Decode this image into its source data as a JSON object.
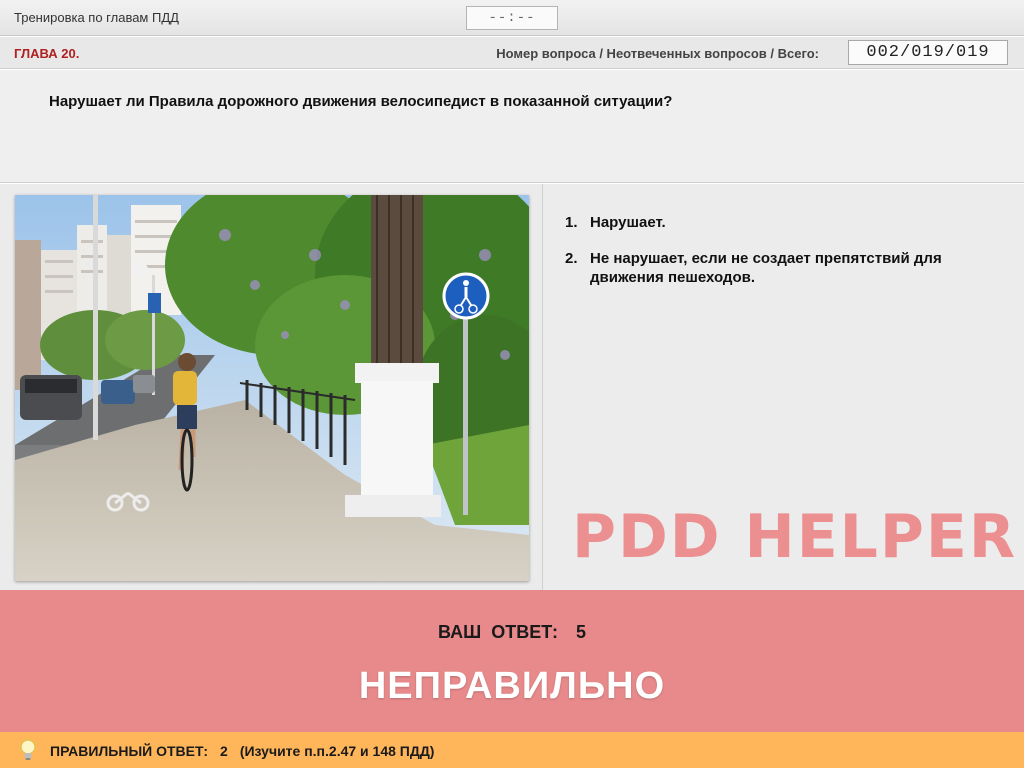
{
  "header": {
    "title": "Тренировка по главам ПДД",
    "timer": "--:--"
  },
  "infobar": {
    "chapter": "ГЛАВА 20.",
    "counter_label": "Номер вопроса / Неотвеченных вопросов / Всего:",
    "counter_value": "002/019/019"
  },
  "question": {
    "text": "Нарушает ли Правила дорожного движения велосипедист в показанной ситуации?"
  },
  "answers": [
    {
      "num": "1.",
      "text": "Нарушает."
    },
    {
      "num": "2.",
      "text": "Не нарушает, если не создает препятствий для движения пешеходов."
    }
  ],
  "watermark": "PDD HELPER",
  "result": {
    "your_answer_label": "ВАШ  ОТВЕТ:",
    "your_answer_value": "5",
    "verdict": "НЕПРАВИЛЬНО"
  },
  "correct": {
    "label": "ПРАВИЛЬНЫЙ ОТВЕТ:",
    "value": "2",
    "hint": "(Изучите п.п.2.47 и 148 ПДД)"
  },
  "colors": {
    "result_bg": "#e88a8b",
    "correct_bg": "#ffb65a",
    "chapter": "#b02020",
    "watermark": "#ec8f91"
  }
}
